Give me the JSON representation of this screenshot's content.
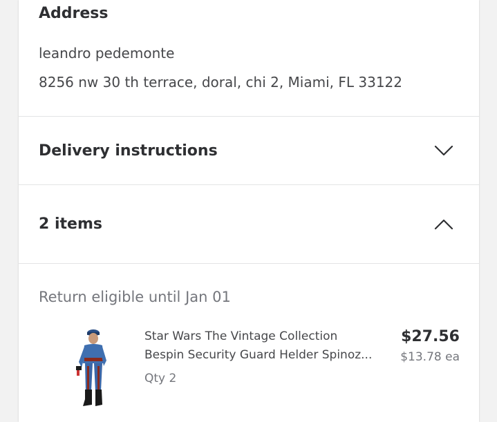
{
  "address": {
    "heading": "Address",
    "name": "leandro pedemonte",
    "street": "8256 nw 30 th terrace, doral, chi 2, Miami, FL 33122"
  },
  "delivery": {
    "title": "Delivery instructions",
    "icon": "chevron-down-icon"
  },
  "items": {
    "title": "2 items",
    "icon": "chevron-up-icon",
    "return_note": "Return eligible until Jan 01",
    "products": [
      {
        "name_line1": "Star Wars The Vintage Collection",
        "name_line2": "Bespin Security Guard Helder Spinoz...",
        "qty": "Qty 2",
        "price_total": "$27.56",
        "price_each": "$13.78 ea"
      }
    ]
  },
  "colors": {
    "text_primary": "#2e2f32",
    "text_secondary": "#74767c",
    "divider": "#e3e4e5"
  }
}
